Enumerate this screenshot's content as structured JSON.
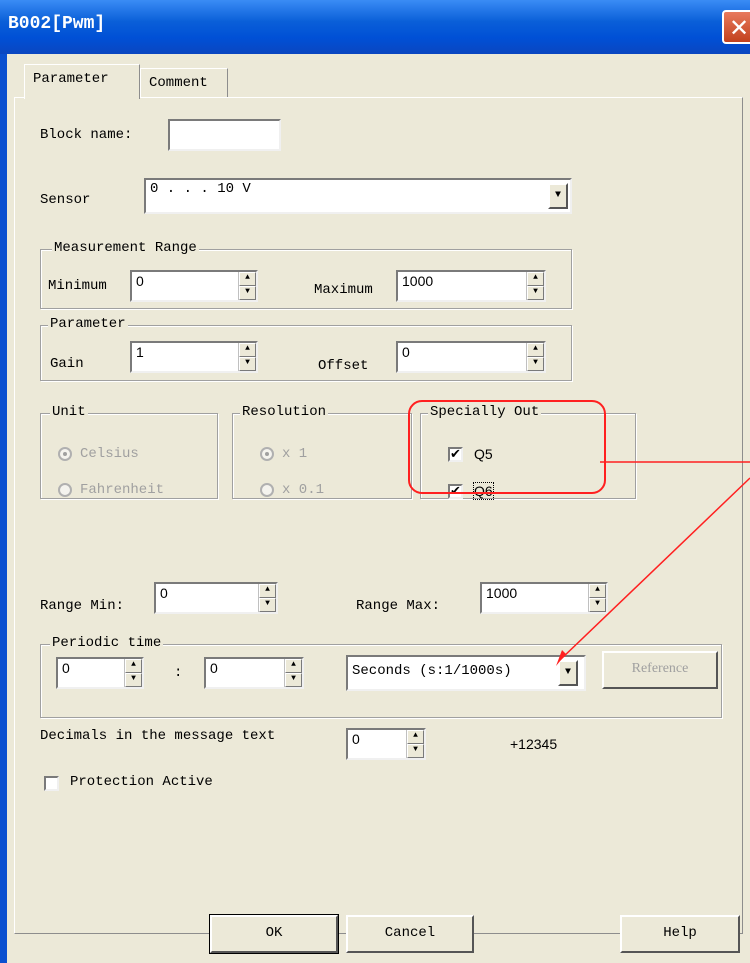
{
  "window": {
    "title": "B002[Pwm]",
    "close_glyph": "✕"
  },
  "tabs": [
    {
      "label": "Parameter"
    },
    {
      "label": "Comment"
    }
  ],
  "block_name": {
    "label": "Block name:",
    "value": ""
  },
  "sensor": {
    "label": "Sensor",
    "value": "0 . . . 10 V"
  },
  "measurement_range": {
    "title": "Measurement Range",
    "min_label": "Minimum",
    "min_value": "0",
    "max_label": "Maximum",
    "max_value": "1000"
  },
  "parameter": {
    "title": "Parameter",
    "gain_label": "Gain",
    "gain_value": "1",
    "offset_label": "Offset",
    "offset_value": "0"
  },
  "unit": {
    "title": "Unit",
    "options": [
      "Celsius",
      "Fahrenheit"
    ],
    "selected": "Celsius"
  },
  "resolution": {
    "title": "Resolution",
    "options": [
      "x 1",
      "x 0.1"
    ],
    "selected": "x 1"
  },
  "specially_out": {
    "title": "Specially Out",
    "items": [
      {
        "label": "Q5",
        "checked": true
      },
      {
        "label": "Q6",
        "checked": true
      }
    ]
  },
  "range": {
    "min_label": "Range Min:",
    "min_value": "0",
    "max_label": "Range Max:",
    "max_value": "1000"
  },
  "periodic_time": {
    "title": "Periodic time",
    "value1": "0",
    "separator": ":",
    "value2": "0",
    "unit_value": "Seconds (s:1/1000s)",
    "reference_label": "Reference"
  },
  "decimals": {
    "label": "Decimals in the message text",
    "value": "0",
    "preview": "+12345"
  },
  "protection": {
    "label": "Protection Active",
    "checked": false
  },
  "buttons": {
    "ok": "OK",
    "cancel": "Cancel",
    "help": "Help"
  },
  "colors": {
    "titlebar": "#0050d6",
    "annotation": "#ff2020",
    "dialog_bg": "#ece9d8"
  },
  "icons": {
    "checkmark": "✔",
    "spin_up": "▲",
    "spin_down": "▼",
    "dropdown": "▼"
  }
}
